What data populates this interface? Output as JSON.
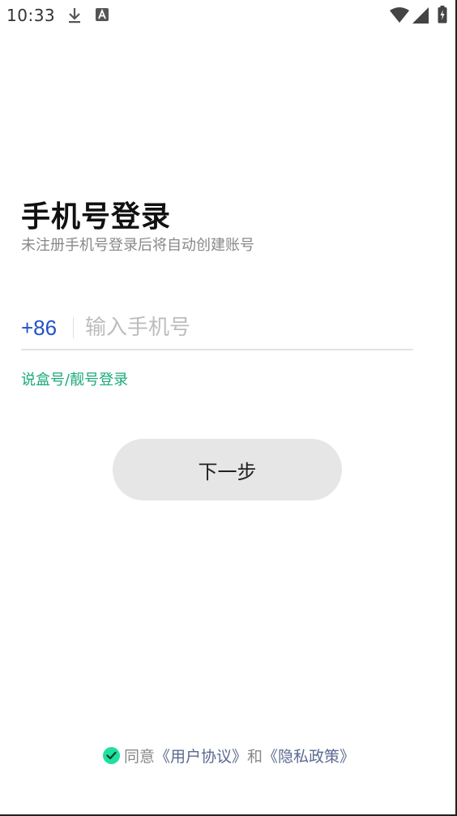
{
  "status_bar": {
    "time": "10:33"
  },
  "login": {
    "title": "手机号登录",
    "subtitle": "未注册手机号登录后将自动创建账号",
    "country_code": "+86",
    "phone_placeholder": "输入手机号",
    "phone_value": "",
    "alt_login_label": "说盒号/靓号登录",
    "next_label": "下一步"
  },
  "agreement": {
    "checked": true,
    "prefix": "同意",
    "user_agreement": "《用户协议》",
    "and": "和",
    "privacy_policy": "《隐私政策》"
  },
  "colors": {
    "accent_blue": "#2450c8",
    "accent_green": "#1aaa7a",
    "check_green": "#1ee0a0"
  }
}
